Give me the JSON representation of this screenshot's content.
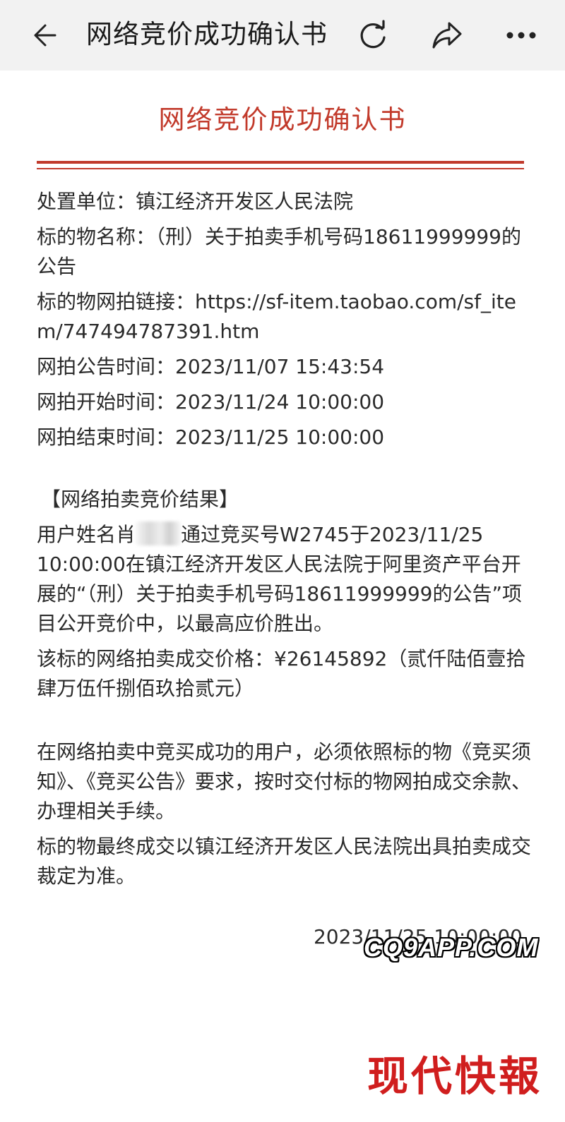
{
  "topbar": {
    "title": "网络竞价成功确认书",
    "icons": [
      "back-arrow-icon",
      "refresh-icon",
      "share-icon",
      "more-icon"
    ]
  },
  "document": {
    "title": "网络竞价成功确认书",
    "accent_color": "#c23a2b",
    "disposal_unit": {
      "label": "处置单位：",
      "value": "镇江经济开发区人民法院"
    },
    "item_name": {
      "label": "标的物名称：",
      "value": "（刑）关于拍卖手机号码18611999999的公告"
    },
    "item_link": {
      "label": "标的物网拍链接：",
      "value": "https://sf-item.taobao.com/sf_item/747494787391.htm"
    },
    "announce_time": {
      "label": "网拍公告时间：",
      "value": "2023/11/07 15:43:54"
    },
    "start_time": {
      "label": "网拍开始时间：",
      "value": "2023/11/24 10:00:00"
    },
    "end_time": {
      "label": "网拍结束时间：",
      "value": "2023/11/25 10:00:00"
    },
    "result_heading": "【网络拍卖竞价结果】",
    "result_p1_before": "用户姓名肖",
    "result_p1_after": "通过竞买号W2745于2023/11/25 10:00:00在镇江经济开发区人民法院于阿里资产平台开展的“（刑）关于拍卖手机号码18611999999的公告”项目公开竞价中，以最高应价胜出。",
    "result_p2": "该标的网络拍卖成交价格：¥26145892（贰仟陆佰壹拾肆万伍仟捌佰玖拾贰元）",
    "notice_p1": "在网络拍卖中竞买成功的用户，必须依照标的物《竞买须知》、《竞买公告》要求，按时交付标的物网拍成交余款、办理相关手续。",
    "notice_p2": "标的物最终成交以镇江经济开发区人民法院出具拍卖成交裁定为准。",
    "footer_date": "2023/11/25 10:00:00"
  },
  "overlays": {
    "watermark": "CQ9APP.COM",
    "logo": "现代快報"
  }
}
